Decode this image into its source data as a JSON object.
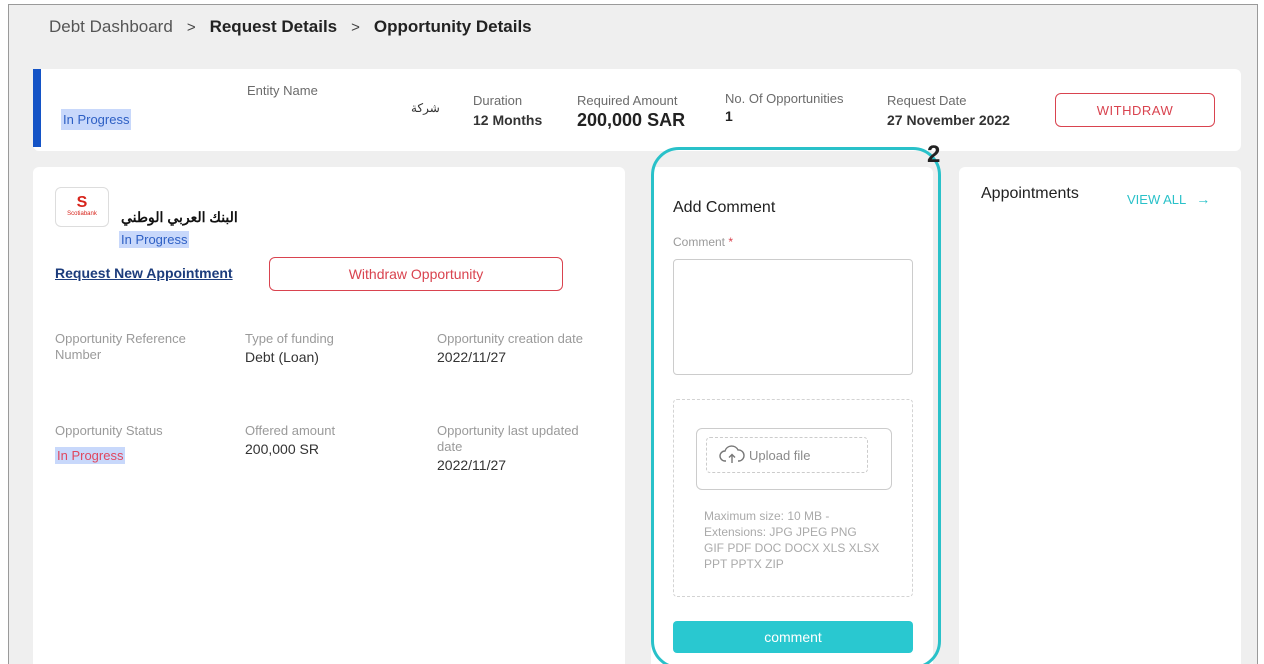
{
  "breadcrumb": {
    "items": [
      "Debt Dashboard",
      "Request Details",
      "Opportunity Details"
    ],
    "separator": ">"
  },
  "summary": {
    "status": "In Progress",
    "entity_label": "Entity Name",
    "entity_value": "شركة",
    "duration_label": "Duration",
    "duration_value": "12 Months",
    "amount_label": "Required Amount",
    "amount_value": "200,000 SAR",
    "opps_label": "No. Of Opportunities",
    "opps_value": "1",
    "date_label": "Request Date",
    "date_value": "27 November 2022",
    "withdraw_label": "WITHDRAW"
  },
  "opportunity": {
    "bank_logo_text": "Scotiabank",
    "bank_name": "البنك العربي الوطني",
    "status": "In Progress",
    "request_appointment_label": "Request New Appointment",
    "withdraw_opportunity_label": "Withdraw Opportunity",
    "fields": {
      "ref_label": "Opportunity Reference Number",
      "ref_value": "",
      "type_label": "Type of funding",
      "type_value": "Debt (Loan)",
      "created_label": "Opportunity creation date",
      "created_value": "2022/11/27",
      "status_label": "Opportunity Status",
      "status_value": "In Progress",
      "offered_label": "Offered amount",
      "offered_value": "200,000 SR",
      "updated_label": "Opportunity last updated date",
      "updated_value": "2022/11/27"
    }
  },
  "comment": {
    "title": "Add Comment",
    "label": "Comment",
    "required_mark": "*",
    "value": "",
    "upload_label": "Upload file",
    "upload_hint": "Maximum size: 10 MB - Extensions: JPG JPEG PNG GIF PDF DOC DOCX XLS XLSX PPT PPTX ZIP",
    "submit_label": "comment",
    "step_number": "2"
  },
  "appointments": {
    "title": "Appointments",
    "view_all_label": "VIEW ALL",
    "arrow": "→"
  },
  "colors": {
    "accent_blue": "#1453c6",
    "highlight": "#c8d8fb",
    "danger": "#d9434f",
    "teal": "#29c8d0"
  }
}
